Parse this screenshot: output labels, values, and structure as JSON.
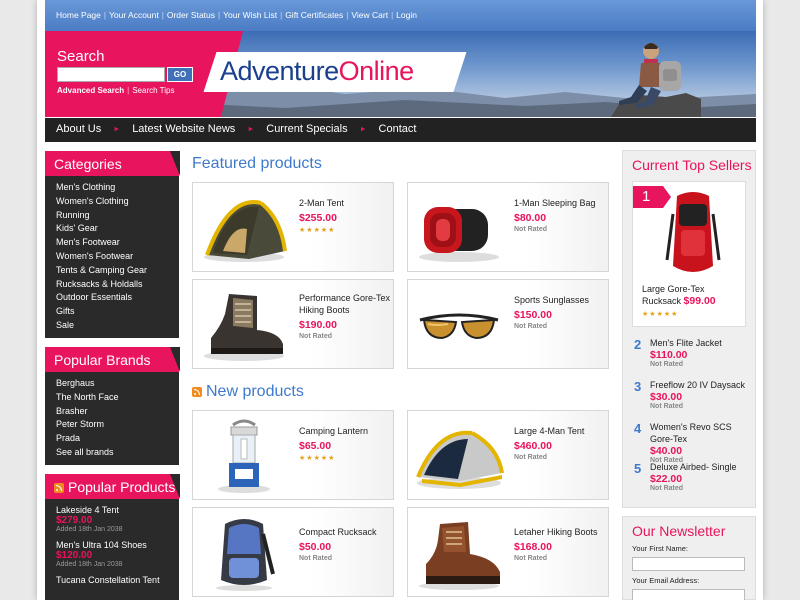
{
  "topbar": {
    "links": [
      "Home Page",
      "Your Account",
      "Order Status",
      "Your Wish List",
      "Gift Certificates",
      "View Cart",
      "Login"
    ],
    "separator": "|"
  },
  "header": {
    "search_title": "Search",
    "search_value": "",
    "go_label": "GO",
    "advanced_search": "Advanced Search",
    "search_tips": "Search Tips",
    "logo_part1": "Adventure",
    "logo_part2": "Online"
  },
  "nav": {
    "items": [
      "About Us",
      "Latest Website News",
      "Current Specials",
      "Contact"
    ],
    "arrow": "►"
  },
  "categories": {
    "title": "Categories",
    "items": [
      "Men's Clothing",
      "Women's Clothing",
      "Running",
      "Kids' Gear",
      "Men's Footwear",
      "Women's Footwear",
      "Tents & Camping Gear",
      "Rucksacks & Holdalls",
      "Outdoor Essentials",
      "Gifts",
      "Sale"
    ]
  },
  "brands": {
    "title": "Popular Brands",
    "items": [
      "Berghaus",
      "The North Face",
      "Brasher",
      "Peter Storm",
      "Prada",
      "See all brands"
    ]
  },
  "popular_products": {
    "title": "Popular Products",
    "items": [
      {
        "name": "Lakeside 4 Tent",
        "price": "$279.00",
        "date": "Added 18th Jan 2038"
      },
      {
        "name": "Men's Ultra 104 Shoes",
        "price": "$120.00",
        "date": "Added 18th Jan 2038"
      },
      {
        "name": "Tucana Constellation Tent",
        "price": "",
        "date": ""
      }
    ]
  },
  "featured": {
    "title": "Featured products",
    "products": [
      {
        "name": "2-Man Tent",
        "price": "$255.00",
        "rating": "",
        "stars": 5,
        "icon": "tent-icon"
      },
      {
        "name": "1-Man Sleeping Bag",
        "price": "$80.00",
        "rating": "Not Rated",
        "stars": 0,
        "icon": "sleeping-bag-icon"
      },
      {
        "name": "Performance Gore-Tex Hiking Boots",
        "price": "$190.00",
        "rating": "Not Rated",
        "stars": 0,
        "icon": "hiking-boot-icon"
      },
      {
        "name": "Sports Sunglasses",
        "price": "$150.00",
        "rating": "Not Rated",
        "stars": 0,
        "icon": "sunglasses-icon"
      }
    ]
  },
  "new_products": {
    "title": "New products",
    "products": [
      {
        "name": "Camping Lantern",
        "price": "$65.00",
        "rating": "",
        "stars": 5,
        "icon": "lantern-icon"
      },
      {
        "name": "Large 4-Man Tent",
        "price": "$460.00",
        "rating": "Not Rated",
        "stars": 0,
        "icon": "large-tent-icon"
      },
      {
        "name": "Compact Rucksack",
        "price": "$50.00",
        "rating": "Not Rated",
        "stars": 0,
        "icon": "rucksack-icon"
      },
      {
        "name": "Letaher Hiking Boots",
        "price": "$168.00",
        "rating": "Not Rated",
        "stars": 0,
        "icon": "leather-boot-icon"
      }
    ]
  },
  "top_sellers": {
    "title": "Current Top Sellers",
    "first": {
      "rank": "1",
      "name": "Large Gore-Tex Rucksack",
      "price": "$99.00",
      "stars": 5
    },
    "items": [
      {
        "rank": "2",
        "name": "Men's Flite Jacket",
        "price": "$110.00",
        "rating": "Not Rated"
      },
      {
        "rank": "3",
        "name": "Freeflow 20 IV Daysack",
        "price": "$30.00",
        "rating": "Not Rated"
      },
      {
        "rank": "4",
        "name": "Women's Revo SCS Gore-Tex",
        "price": "$40.00",
        "rating": "Not Rated"
      },
      {
        "rank": "5",
        "name": "Deluxe Airbed- Single",
        "price": "$22.00",
        "rating": "Not Rated"
      }
    ]
  },
  "newsletter": {
    "title": "Our Newsletter",
    "first_name_label": "Your First Name:",
    "email_label": "Your Email Address:"
  },
  "colors": {
    "accent": "#e8145e",
    "blue": "#3e7acb",
    "dark": "#222222"
  }
}
